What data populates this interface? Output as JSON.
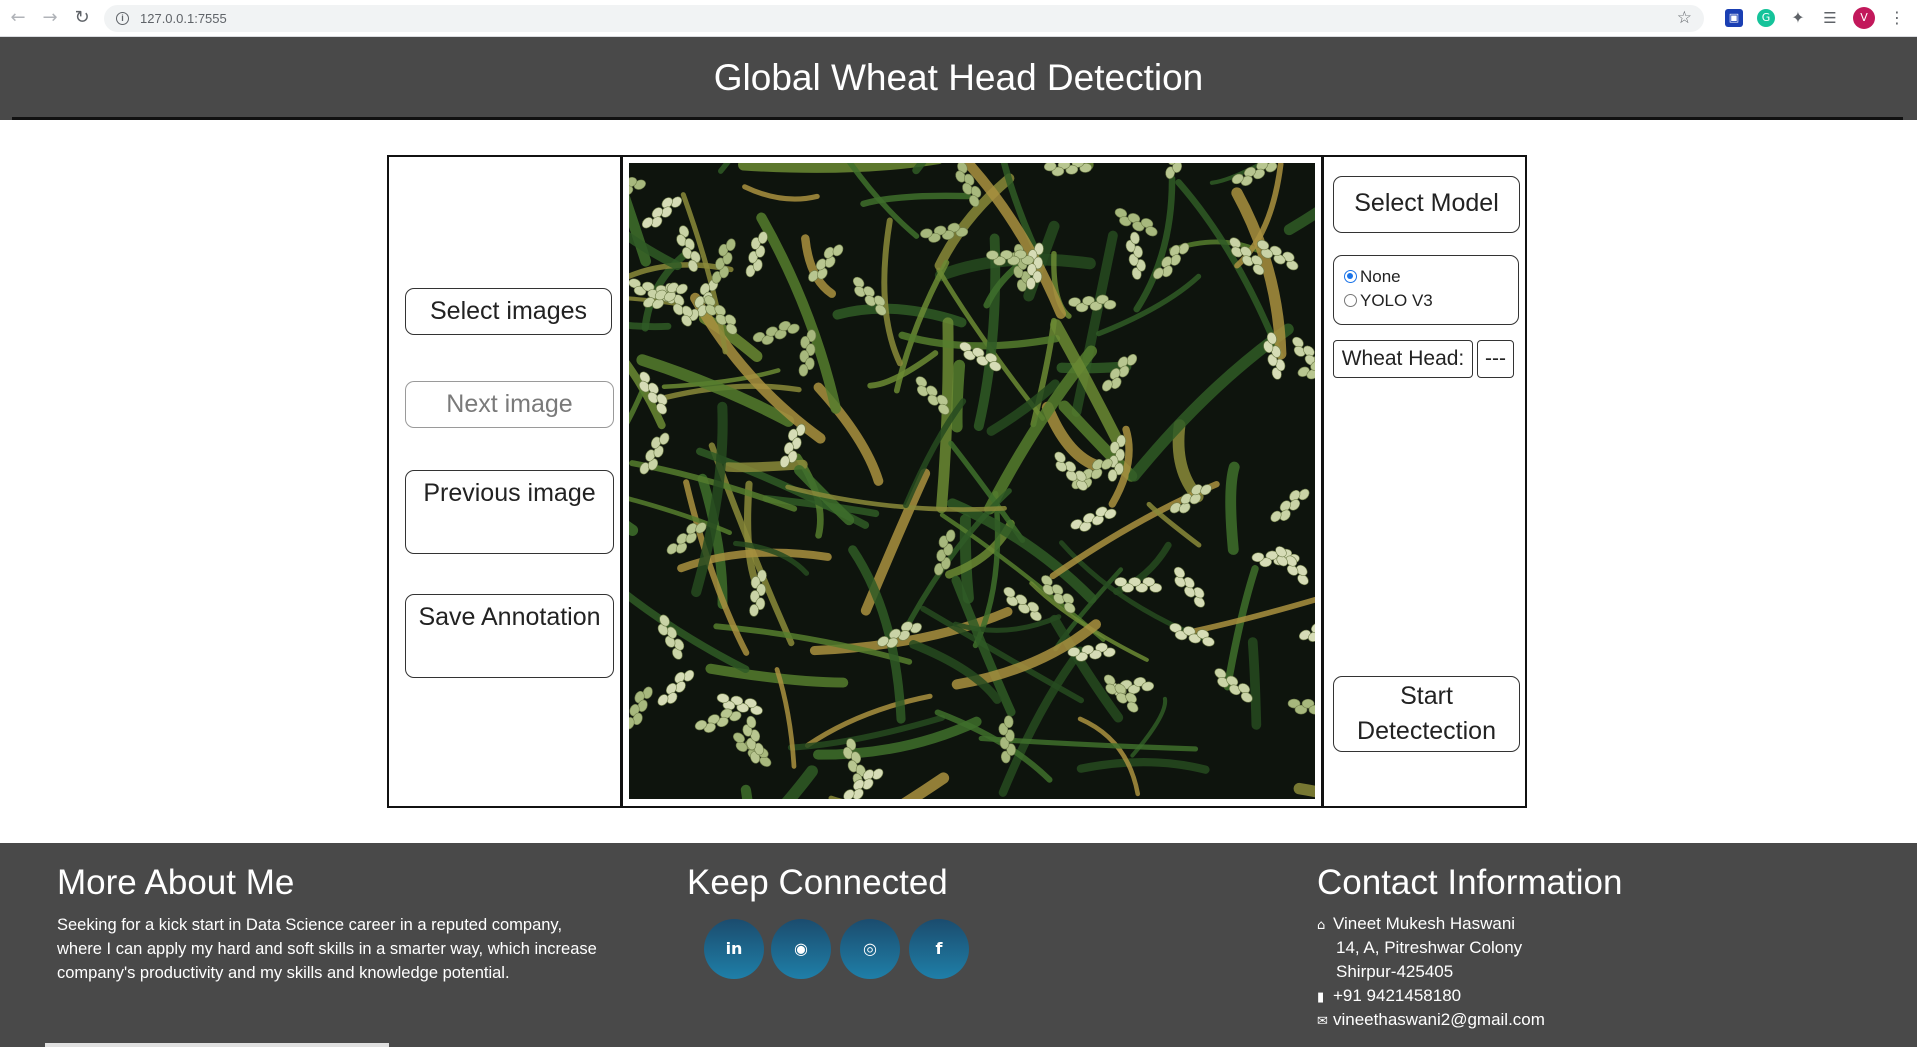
{
  "browser": {
    "url": "127.0.0.1:7555",
    "profile_initial": "V"
  },
  "header": {
    "title": "Global Wheat Head Detection"
  },
  "left_panel": {
    "select_images": "Select images",
    "next_image": "Next image",
    "previous_image": "Previous image",
    "save_annotation": "Save Annotation"
  },
  "right_panel": {
    "select_model": "Select Model",
    "model_options": [
      {
        "label": "None",
        "selected": true
      },
      {
        "label": "YOLO V3",
        "selected": false
      }
    ],
    "wheat_head_label": "Wheat Head:",
    "wheat_head_value": "---",
    "start_detection": "Start Detectection"
  },
  "footer": {
    "about": {
      "title": "More About Me",
      "text": "Seeking for a kick start in Data Science career in a reputed company, where I can apply my hard and soft skills in a smarter way, which increase company's productivity and my skills and knowledge potential."
    },
    "connected": {
      "title": "Keep Connected",
      "links": [
        {
          "icon": "linkedin-icon",
          "glyph": "in"
        },
        {
          "icon": "github-icon",
          "glyph": "◉"
        },
        {
          "icon": "instagram-icon",
          "glyph": "◎"
        },
        {
          "icon": "facebook-icon",
          "glyph": "f"
        }
      ]
    },
    "contact": {
      "title": "Contact Information",
      "name": "Vineet Mukesh Haswani",
      "address_1": "14, A, Pitreshwar Colony",
      "address_2": "Shirpur-425405",
      "phone": "+91 9421458180",
      "email": "vineethaswani2@gmail.com"
    }
  },
  "colors": {
    "header_bg": "#494949",
    "footer_bg": "#494949",
    "social_gradient_top": "#1b4c6e",
    "social_gradient_bottom": "#1f7fa8",
    "radio_accent": "#1a73e8"
  }
}
